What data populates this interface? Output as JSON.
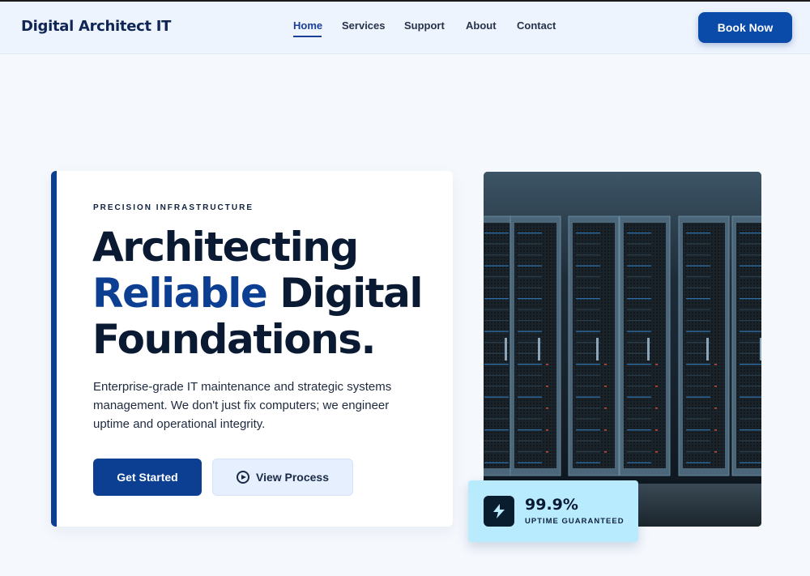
{
  "header": {
    "brand": "Digital Architect IT",
    "nav": [
      {
        "label": "Home",
        "active": true
      },
      {
        "label": "Services",
        "active": false
      },
      {
        "label": "Support",
        "active": false
      },
      {
        "label": "About",
        "active": false
      },
      {
        "label": "Contact",
        "active": false
      }
    ],
    "cta_label": "Book Now"
  },
  "hero": {
    "eyebrow": "PRECISION INFRASTRUCTURE",
    "headline_line1": "Architecting",
    "headline_accent": "Reliable",
    "headline_line2_rest": " Digital",
    "headline_line3": "Foundations.",
    "description": "Enterprise-grade IT maintenance and strategic systems management. We don't just fix computers; we engineer uptime and operational integrity.",
    "primary_button": "Get Started",
    "secondary_button": "View Process",
    "secondary_icon": "play-circle-icon"
  },
  "image": {
    "subject": "server-racks"
  },
  "badge": {
    "icon": "lightning-bolt-icon",
    "value": "99.9%",
    "label": "UPTIME GUARANTEED"
  },
  "colors": {
    "brand": "#0c3f92",
    "cta": "#0a4aa8",
    "background": "#f5f8fd",
    "badge_bg": "#b9ebff"
  }
}
